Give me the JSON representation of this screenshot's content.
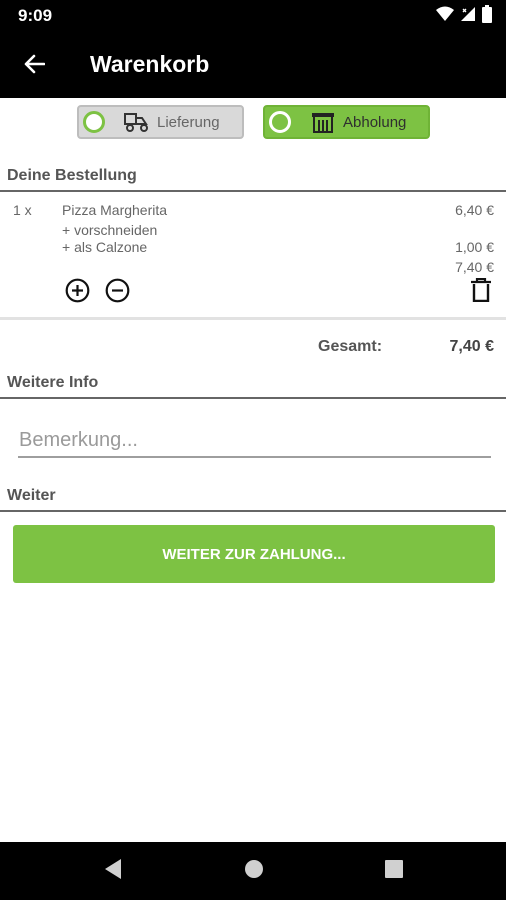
{
  "status_bar": {
    "time": "9:09",
    "icons": [
      "wifi-icon",
      "signal-icon",
      "battery-icon"
    ]
  },
  "app_bar": {
    "back_icon": "arrow-left-icon",
    "title": "Warenkorb"
  },
  "delivery_mode": {
    "options": [
      {
        "label": "Lieferung",
        "icon": "delivery-scooter-icon",
        "selected": false
      },
      {
        "label": "Abholung",
        "icon": "store-icon",
        "selected": true
      }
    ]
  },
  "order": {
    "section_title": "Deine Bestellung",
    "items": [
      {
        "quantity": "1 x",
        "name": "Pizza Margherita",
        "price": "6,40 €",
        "extras": [
          {
            "label": "+ vorschneiden",
            "price": ""
          },
          {
            "label": "+ als Calzone",
            "price": "1,00 €"
          }
        ],
        "subtotal": "7,40 €"
      }
    ],
    "total_label": "Gesamt:",
    "total_value": "7,40 €"
  },
  "info": {
    "section_title": "Weitere Info",
    "remark_placeholder": "Bemerkung...",
    "remark_value": ""
  },
  "next": {
    "section_title": "Weiter",
    "button_label": "WEITER ZUR ZAHLUNG..."
  },
  "colors": {
    "accent": "#7dc243",
    "bar": "#000000",
    "toggle_inactive": "#d9d9d9"
  },
  "nav_bar": {
    "icons": [
      "back-triangle-icon",
      "home-circle-icon",
      "recents-square-icon"
    ]
  }
}
